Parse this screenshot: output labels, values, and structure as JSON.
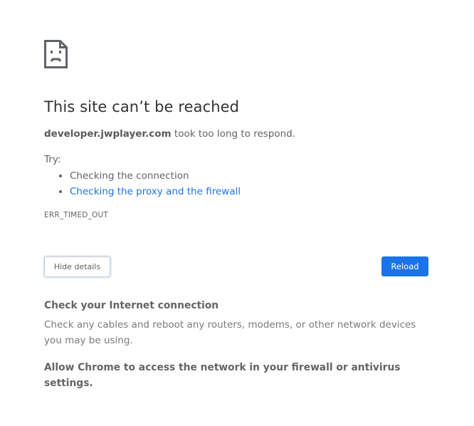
{
  "icon": "sad-page-icon",
  "title": "This site can’t be reached",
  "summary": {
    "host": "developer.jwplayer.com",
    "message": " took too long to respond."
  },
  "try_label": "Try:",
  "suggestions": [
    {
      "label": "Checking the connection",
      "link": false
    },
    {
      "label": "Checking the proxy and the firewall",
      "link": true
    }
  ],
  "error_code": "ERR_TIMED_OUT",
  "buttons": {
    "details_label": "Hide details",
    "reload_label": "Reload"
  },
  "details": {
    "heading": "Check your Internet connection",
    "text": "Check any cables and reboot any routers, modems, or other network devices you may be using.",
    "allow_text": "Allow Chrome to access the network in your firewall or antivirus settings."
  },
  "colors": {
    "link": "#1a73e8",
    "reload_bg": "#1a73e8",
    "title": "#333333",
    "body_text": "#646464"
  }
}
